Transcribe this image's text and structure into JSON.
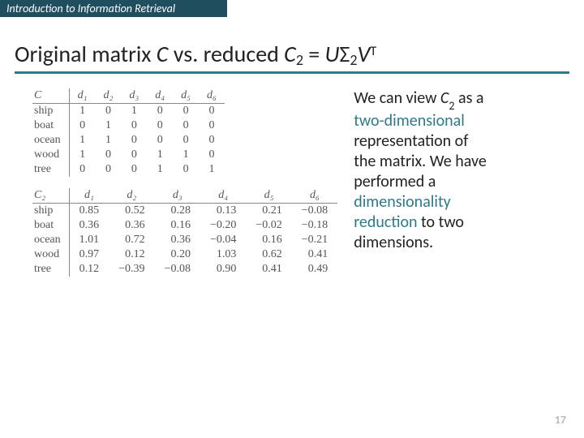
{
  "header": {
    "text": "Introduction to Information Retrieval"
  },
  "title": {
    "t1": "Original matrix ",
    "C": "C",
    "t2": " vs. reduced ",
    "C2a": "C",
    "C2b": "2",
    "eq": " = ",
    "U": "U",
    "Sigma": "Σ",
    "two": "2",
    "V": "V",
    "T": "T"
  },
  "table1": {
    "corner": "C",
    "headers": [
      "d₁",
      "d₂",
      "d₃",
      "d₄",
      "d₅",
      "d₆"
    ],
    "rows": [
      {
        "label": "ship",
        "vals": [
          "1",
          "0",
          "1",
          "0",
          "0",
          "0"
        ]
      },
      {
        "label": "boat",
        "vals": [
          "0",
          "1",
          "0",
          "0",
          "0",
          "0"
        ]
      },
      {
        "label": "ocean",
        "vals": [
          "1",
          "1",
          "0",
          "0",
          "0",
          "0"
        ]
      },
      {
        "label": "wood",
        "vals": [
          "1",
          "0",
          "0",
          "1",
          "1",
          "0"
        ]
      },
      {
        "label": "tree",
        "vals": [
          "0",
          "0",
          "0",
          "1",
          "0",
          "1"
        ]
      }
    ]
  },
  "table2": {
    "corner": "C₂",
    "headers": [
      "d₁",
      "d₂",
      "d₃",
      "d₄",
      "d₅",
      "d₆"
    ],
    "rows": [
      {
        "label": "ship",
        "vals": [
          "0.85",
          "0.52",
          "0.28",
          "0.13",
          "0.21",
          "−0.08"
        ]
      },
      {
        "label": "boat",
        "vals": [
          "0.36",
          "0.36",
          "0.16",
          "−0.20",
          "−0.02",
          "−0.18"
        ]
      },
      {
        "label": "ocean",
        "vals": [
          "1.01",
          "0.72",
          "0.36",
          "−0.04",
          "0.16",
          "−0.21"
        ]
      },
      {
        "label": "wood",
        "vals": [
          "0.97",
          "0.12",
          "0.20",
          "1.03",
          "0.62",
          "0.41"
        ]
      },
      {
        "label": "tree",
        "vals": [
          "0.12",
          "−0.39",
          "−0.08",
          "0.90",
          "0.41",
          "0.49"
        ]
      }
    ]
  },
  "sidetext": {
    "l1": "We can view ",
    "C": "C",
    "sub2": "2",
    "l2": " as a ",
    "em1": "two-dimensional",
    "l3": " representation of the matrix. We have performed a ",
    "em2": "dimensionality reduction",
    "l4": " to two dimensions."
  },
  "footer": {
    "page": "17"
  }
}
